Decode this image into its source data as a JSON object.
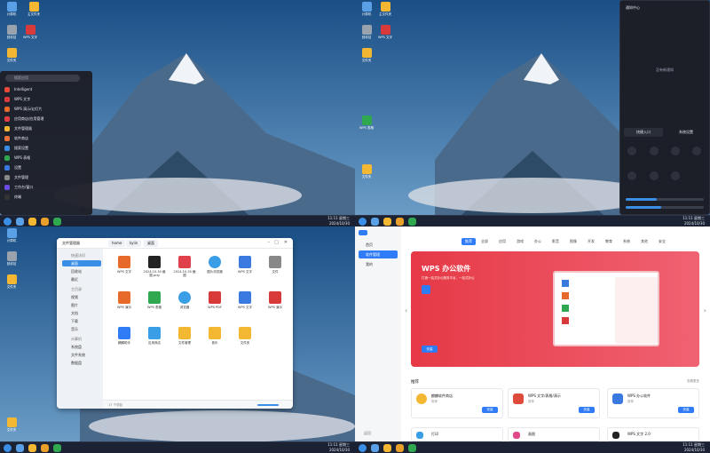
{
  "desktop": {
    "icons": [
      {
        "label": "计算机",
        "color": "#5aa0e6"
      },
      {
        "label": "主文件夹",
        "color": "#f4b731"
      },
      {
        "label": "2024-10-30 回收站",
        "color": "#888"
      },
      {
        "label": "回收站",
        "color": "#9aa3ad"
      },
      {
        "label": "WPS 文字",
        "color": "#d83a3a"
      },
      {
        "label": "WPS 表格",
        "color": "#2fa84f"
      },
      {
        "label": "文件夹",
        "color": "#f4b731"
      },
      {
        "label": "文件夹",
        "color": "#f4b731"
      }
    ],
    "taskbar_time": "11:11 星期三",
    "taskbar_date": "2024/10/30"
  },
  "start_menu": {
    "search_placeholder": "搜索应用",
    "items": [
      {
        "label": "Intelligent",
        "color": "#e84a3a"
      },
      {
        "label": "WPS 文字",
        "color": "#d83a3a"
      },
      {
        "label": "WPS 演示/幻灯片",
        "color": "#e86a2a"
      },
      {
        "label": "应用商店/应用管理",
        "color": "#e04040"
      },
      {
        "label": "文件管理器",
        "color": "#f4b731"
      },
      {
        "label": "软件商店",
        "color": "#e8703a"
      },
      {
        "label": "搜索设置",
        "color": "#3a8ee6"
      },
      {
        "label": "WPS 表格",
        "color": "#2fa84f"
      },
      {
        "label": "设置",
        "color": "#3a7ae0"
      },
      {
        "label": "文件管理",
        "color": "#888"
      },
      {
        "label": "工作台/窗口",
        "color": "#6a4ae0"
      },
      {
        "label": "终端",
        "color": "#333"
      }
    ]
  },
  "control_panel": {
    "title": "通知中心",
    "empty_text": "没有新通知",
    "tabs": [
      "快捷入口",
      "系统设置"
    ]
  },
  "file_manager": {
    "title": "文件管理器",
    "path": [
      "home",
      "kylin",
      "桌面"
    ],
    "sidebar": [
      "快速访问",
      "桌面",
      "回收站",
      "最近",
      "主目录",
      "视频",
      "图片",
      "文档",
      "下载",
      "音乐",
      "计算机",
      "系统盘",
      "文件系统",
      "数据盘"
    ],
    "files": [
      {
        "label": "WPS 文字",
        "color": "#e86a2a"
      },
      {
        "label": "2024-10-30 截图.png",
        "color": "#222"
      },
      {
        "label": "2024-10-30 截图",
        "color": "#e0404a"
      },
      {
        "label": "图片浏览器",
        "color": "#3a9ee6"
      },
      {
        "label": "WPS 文字",
        "color": "#3a7ae0"
      },
      {
        "label": "文件",
        "color": "#888"
      },
      {
        "label": "WPS 演示",
        "color": "#e86a2a"
      },
      {
        "label": "WPS 表格",
        "color": "#2fa84f"
      },
      {
        "label": "浏览器",
        "color": "#3a9ee6"
      },
      {
        "label": "WPS PDF",
        "color": "#d83a3a"
      },
      {
        "label": "WPS 文字",
        "color": "#3a7ae0"
      },
      {
        "label": "WPS 演示",
        "color": "#d83a3a"
      },
      {
        "label": "麒麟助手",
        "color": "#2f7cf6"
      },
      {
        "label": "应用商店",
        "color": "#3a9ee6"
      },
      {
        "label": "文件管理",
        "color": "#f4b731"
      },
      {
        "label": "音乐",
        "color": "#f4b731"
      },
      {
        "label": "文件夹",
        "color": "#f4b731"
      }
    ],
    "status": "17 个项目"
  },
  "store": {
    "nav": [
      "首页",
      "软件管理",
      "我的"
    ],
    "tabs": [
      "推荐",
      "全部",
      "应用",
      "游戏",
      "办公",
      "影音",
      "图像",
      "开发",
      "教育",
      "系统",
      "其他",
      "安全"
    ],
    "banner_title": "WPS 办公软件",
    "banner_sub": "打造一站式办公服务平台，一站式办公",
    "banner_button": "安装",
    "section_title": "推荐",
    "more": "查看更多",
    "cards": [
      {
        "name": "麒麟软件商店",
        "sub": "推荐",
        "color": "#f4b731",
        "button": "安装"
      },
      {
        "name": "WPS 文字/表格/演示",
        "sub": "推荐",
        "color": "#e04a3a",
        "button": "安装"
      },
      {
        "name": "WPS 办公软件",
        "sub": "推荐",
        "color": "#3a7ae0",
        "button": "安装"
      },
      {
        "name": "打印",
        "sub": "推荐",
        "color": "#3a9ee6",
        "button": "安装"
      },
      {
        "name": "画图",
        "sub": "推荐",
        "color": "#e04a8a",
        "button": "安装"
      },
      {
        "name": "WPS 文字 2.0",
        "sub": "推荐",
        "color": "#222",
        "button": "安装"
      }
    ],
    "back": "返回"
  }
}
